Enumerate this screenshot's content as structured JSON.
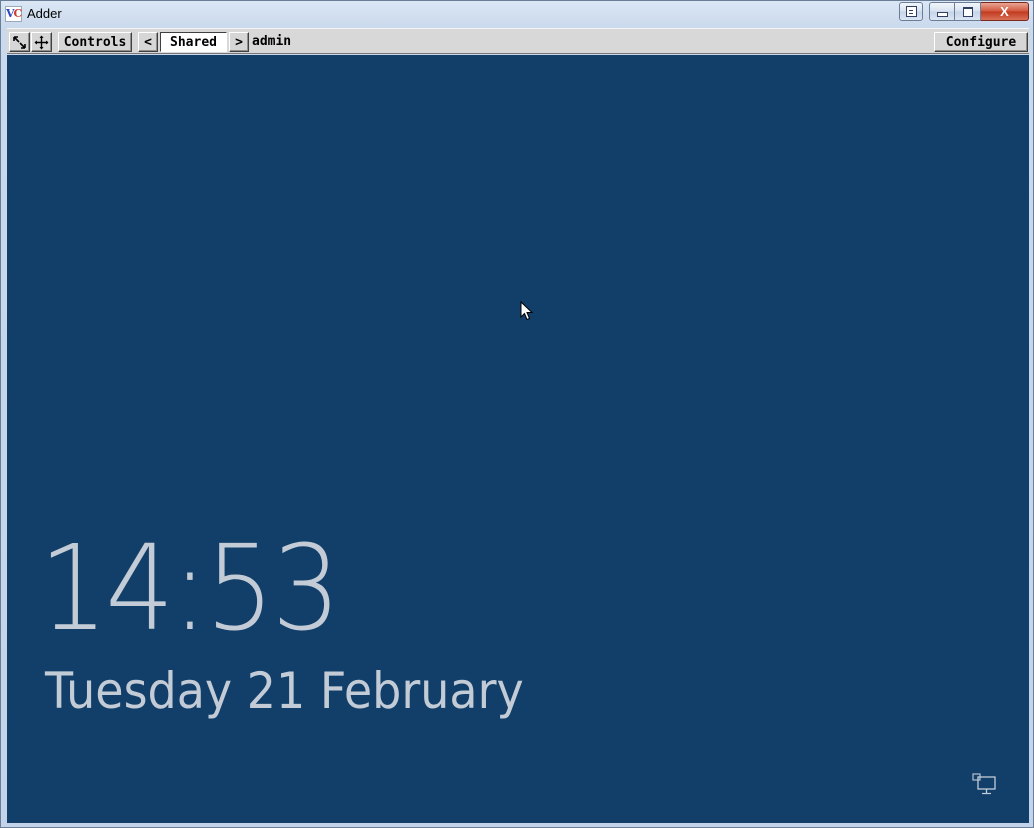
{
  "window": {
    "title": "Adder",
    "icon_text": "VC",
    "controls": {
      "extra": "restore-to-window-icon",
      "minimize": "minimize-icon",
      "maximize": "maximize-icon",
      "close_label": "X"
    }
  },
  "toolbar": {
    "scale_icon": "scale-arrows-icon",
    "move_icon": "move-cross-icon",
    "controls_label": "Controls",
    "prev_label": "<",
    "channel_label": "Shared",
    "next_label": ">",
    "user_label": "admin",
    "configure_label": "Configure"
  },
  "lock_screen": {
    "time": "14:53",
    "date": "Tuesday 21 February",
    "background_color": "#123f69",
    "text_color": "#c3ccd6",
    "network_icon": "network-monitor-icon",
    "cursor_icon": "mouse-pointer-icon"
  }
}
